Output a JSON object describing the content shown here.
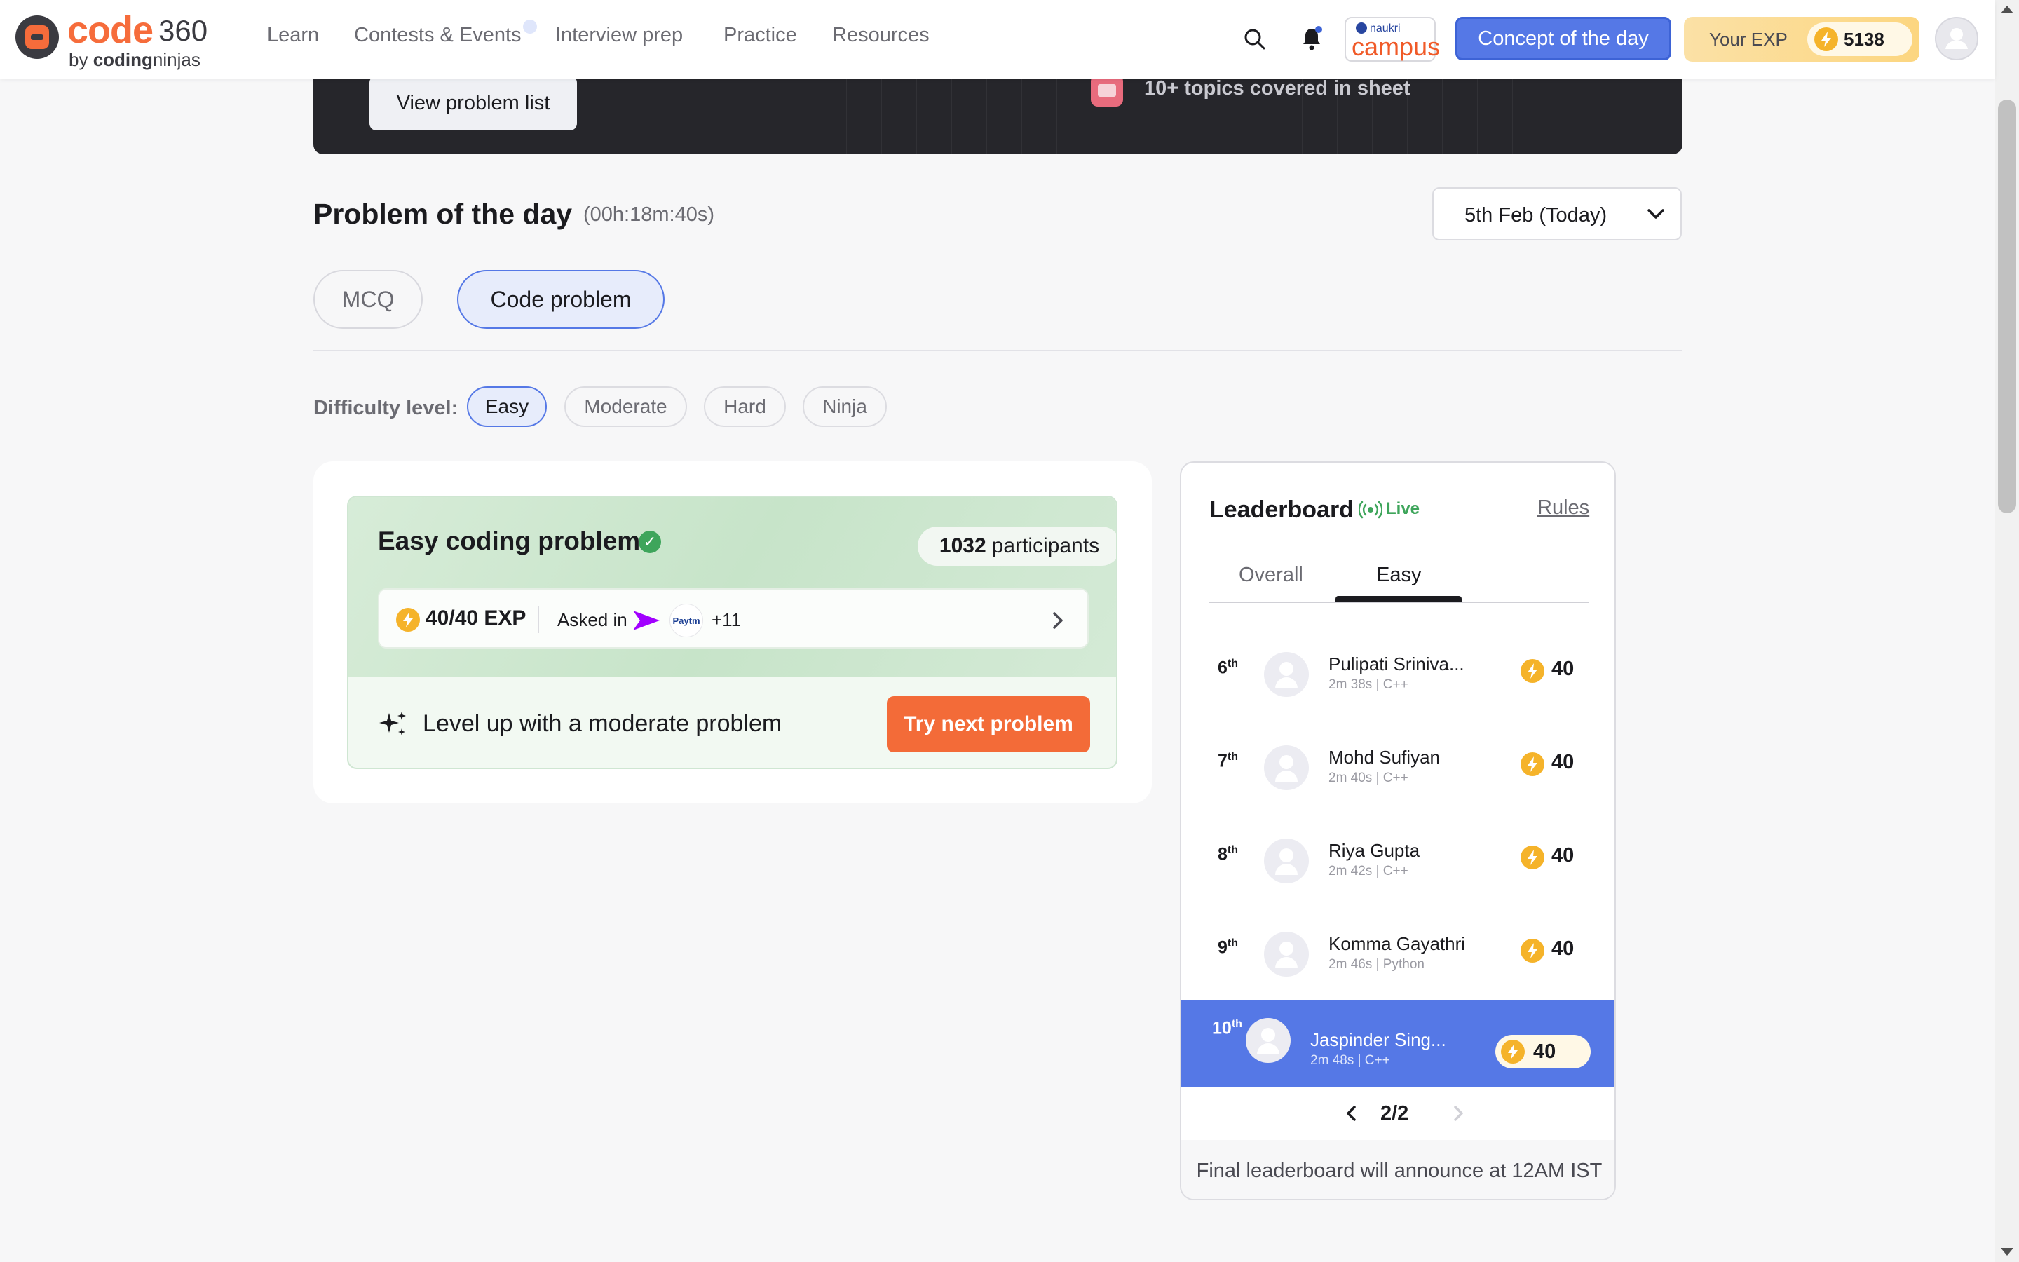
{
  "header": {
    "logo": {
      "code": "code",
      "num": "360",
      "by": "by",
      "brand_a": "coding",
      "brand_b": "ninjas"
    },
    "nav": [
      "Learn",
      "Contests & Events",
      "Interview prep",
      "Practice",
      "Resources"
    ],
    "campus": {
      "top": "naukri",
      "main": "campus"
    },
    "concept_button": "Concept of the day",
    "exp_label": "Your EXP",
    "exp_value": "5138",
    "colors": {
      "primary": "#5578e6",
      "accent": "#f66c3b",
      "exp_gold": "#f5b32a"
    }
  },
  "banner": {
    "view_button": "View problem list",
    "topics": "10+ topics covered in sheet",
    "topics_icon": "book-icon"
  },
  "potd": {
    "title": "Problem of the day",
    "timer": "(00h:18m:40s)",
    "date": "5th Feb  (Today)",
    "tabs": [
      "MCQ",
      "Code problem"
    ],
    "active_tab": "Code problem",
    "difficulty_label": "Difficulty level:",
    "difficulties": [
      "Easy",
      "Moderate",
      "Hard",
      "Ninja"
    ],
    "active_difficulty": "Easy"
  },
  "problem": {
    "title": "Easy coding problem",
    "participants_count": "1032",
    "participants_label": "participants",
    "exp": "40/40 EXP",
    "asked_in": "Asked in",
    "companies": [
      "accenture-logo",
      "paytm-logo"
    ],
    "paytm_text": "Paytm",
    "more_companies": "+11",
    "levelup_text": "Level up with a moderate problem",
    "next_button": "Try next problem"
  },
  "leaderboard": {
    "title": "Leaderboard",
    "live": "Live",
    "rules": "Rules",
    "tabs": [
      "Overall",
      "Easy"
    ],
    "active_tab": "Easy",
    "rows": [
      {
        "rank": "6",
        "suffix": "th",
        "name": "Pulipati Sriniva...",
        "meta": "2m 38s | C++",
        "score": "40"
      },
      {
        "rank": "7",
        "suffix": "th",
        "name": "Mohd Sufiyan",
        "meta": "2m 40s | C++",
        "score": "40"
      },
      {
        "rank": "8",
        "suffix": "th",
        "name": "Riya Gupta",
        "meta": "2m 42s | C++",
        "score": "40"
      },
      {
        "rank": "9",
        "suffix": "th",
        "name": "Komma Gayathri",
        "meta": "2m 46s | Python",
        "score": "40"
      }
    ],
    "current_user": {
      "rank": "10",
      "suffix": "th",
      "name": "Jaspinder Sing...",
      "meta": "2m 48s | C++",
      "score": "40"
    },
    "page": "2/2",
    "footer": "Final leaderboard will announce at 12AM IST"
  }
}
